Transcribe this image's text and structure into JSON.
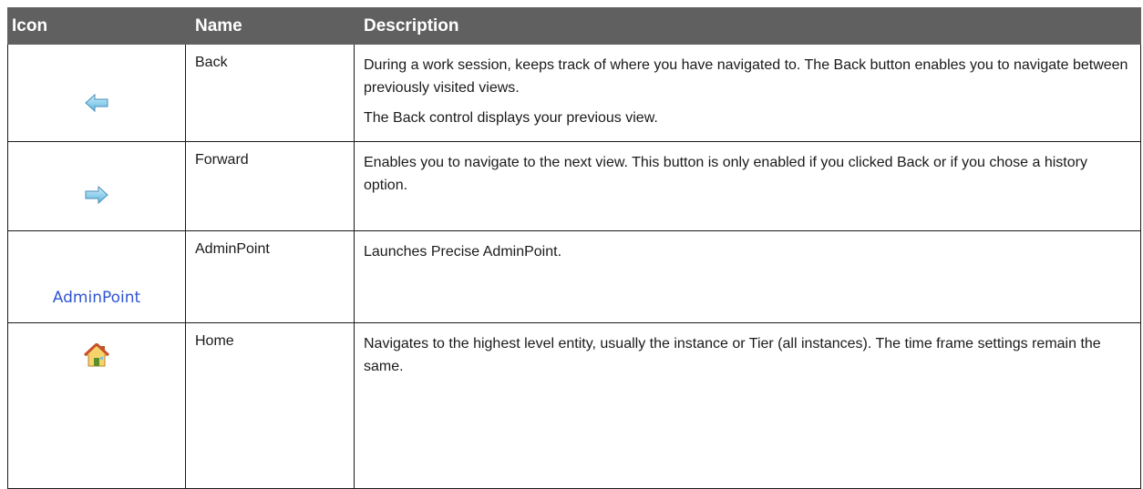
{
  "table": {
    "headers": {
      "icon": "Icon",
      "name": "Name",
      "description": "Description"
    },
    "rows": [
      {
        "icon": "back-arrow-icon",
        "name": "Back",
        "description": [
          "During a work session, keeps track of where you have navigated to. The Back button enables you to navigate between previously visited views.",
          "The Back control displays your previous view."
        ]
      },
      {
        "icon": "forward-arrow-icon",
        "name": "Forward",
        "description": [
          "Enables you to navigate to the next view. This button is only enabled if you clicked Back or if you chose a history option."
        ]
      },
      {
        "icon": "adminpoint-link",
        "icon_text": "AdminPoint",
        "name": "AdminPoint",
        "description": [
          "Launches Precise AdminPoint."
        ]
      },
      {
        "icon": "home-icon",
        "name": "Home",
        "description": [
          "Navigates to the highest level entity, usually the instance or Tier (all instances). The time frame settings remain the same."
        ]
      }
    ]
  },
  "colors": {
    "header_bg": "#606060",
    "header_text": "#ffffff",
    "border": "#1a1a1a",
    "link_blue": "#2f55d4",
    "arrow_fill": "#7ec8ea"
  }
}
